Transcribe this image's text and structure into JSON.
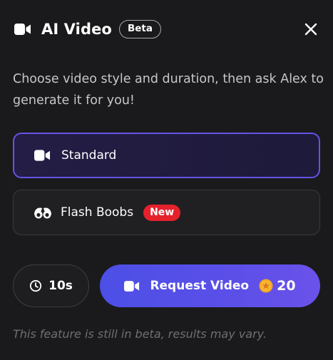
{
  "header": {
    "icon": "video-camera-icon",
    "title": "AI Video",
    "badge": "Beta",
    "close_icon": "close-icon"
  },
  "description": "Choose video style and duration, then ask Alex to generate it for you!",
  "options": [
    {
      "label": "Standard",
      "icon": "video-camera-icon",
      "selected": true
    },
    {
      "label": "Flash Boobs",
      "icon": "boobs-icon",
      "badge": "New",
      "selected": false
    }
  ],
  "duration": {
    "icon": "clock-icon",
    "label": "10s"
  },
  "request": {
    "icon": "video-camera-icon",
    "label": "Request Video",
    "coin_icon": "coin-star-icon",
    "cost": "20"
  },
  "footnote": "This feature is still in beta, results may vary.",
  "colors": {
    "accent": "#5b4fe8",
    "selected_border": "#6554e6",
    "new_badge": "#e5212c",
    "coin": "#f5a623",
    "background": "#1a1a1c"
  }
}
